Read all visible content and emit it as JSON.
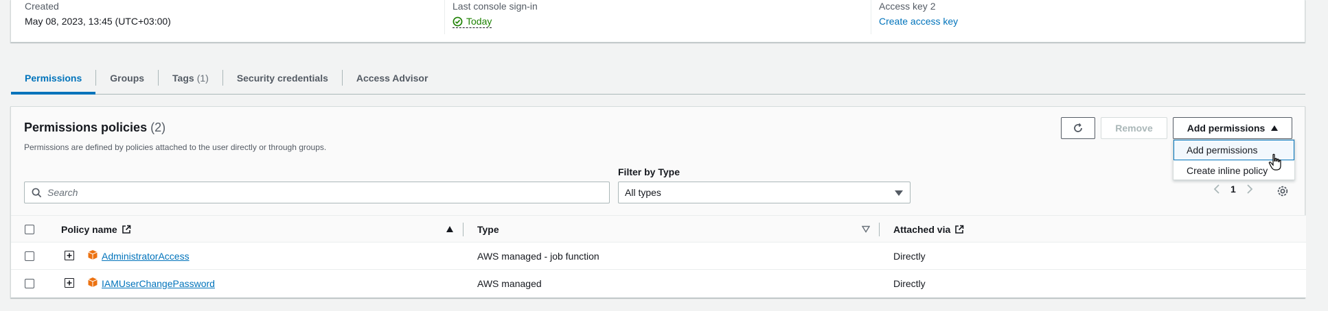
{
  "summary": {
    "created_label": "Created",
    "created_value": "May 08, 2023, 13:45 (UTC+03:00)",
    "last_signin_label": "Last console sign-in",
    "last_signin_value": "Today",
    "access_key_label": "Access key 2",
    "access_key_link": "Create access key"
  },
  "tabs": [
    {
      "label": "Permissions",
      "count": ""
    },
    {
      "label": "Groups",
      "count": ""
    },
    {
      "label": "Tags",
      "count": "(1)"
    },
    {
      "label": "Security credentials",
      "count": ""
    },
    {
      "label": "Access Advisor",
      "count": ""
    }
  ],
  "policies": {
    "title": "Permissions policies",
    "count": "(2)",
    "description": "Permissions are defined by policies attached to the user directly or through groups.",
    "remove_label": "Remove",
    "add_label": "Add permissions",
    "dropdown": [
      "Add permissions",
      "Create inline policy"
    ],
    "filter_label": "Filter by Type",
    "search_placeholder": "Search",
    "filter_value": "All types",
    "page": "1",
    "columns": {
      "policy_name": "Policy name",
      "type": "Type",
      "attached_via": "Attached via"
    },
    "rows": [
      {
        "name": "AdministratorAccess",
        "type": "AWS managed - job function",
        "attached": "Directly"
      },
      {
        "name": "IAMUserChangePassword",
        "type": "AWS managed",
        "attached": "Directly"
      }
    ]
  },
  "colors": {
    "accent": "#0073bb",
    "success": "#1d8102",
    "policy_icon": "#ec7211"
  },
  "icons": [
    "check-circle-icon",
    "refresh-icon",
    "caret-up-icon",
    "hand-cursor-icon",
    "search-icon",
    "caret-down-icon",
    "chevron-left-icon",
    "chevron-right-icon",
    "settings-gear-icon",
    "external-link-icon",
    "sort-ascending-icon",
    "sort-descending-icon",
    "expand-plus-icon",
    "policy-box-icon"
  ]
}
